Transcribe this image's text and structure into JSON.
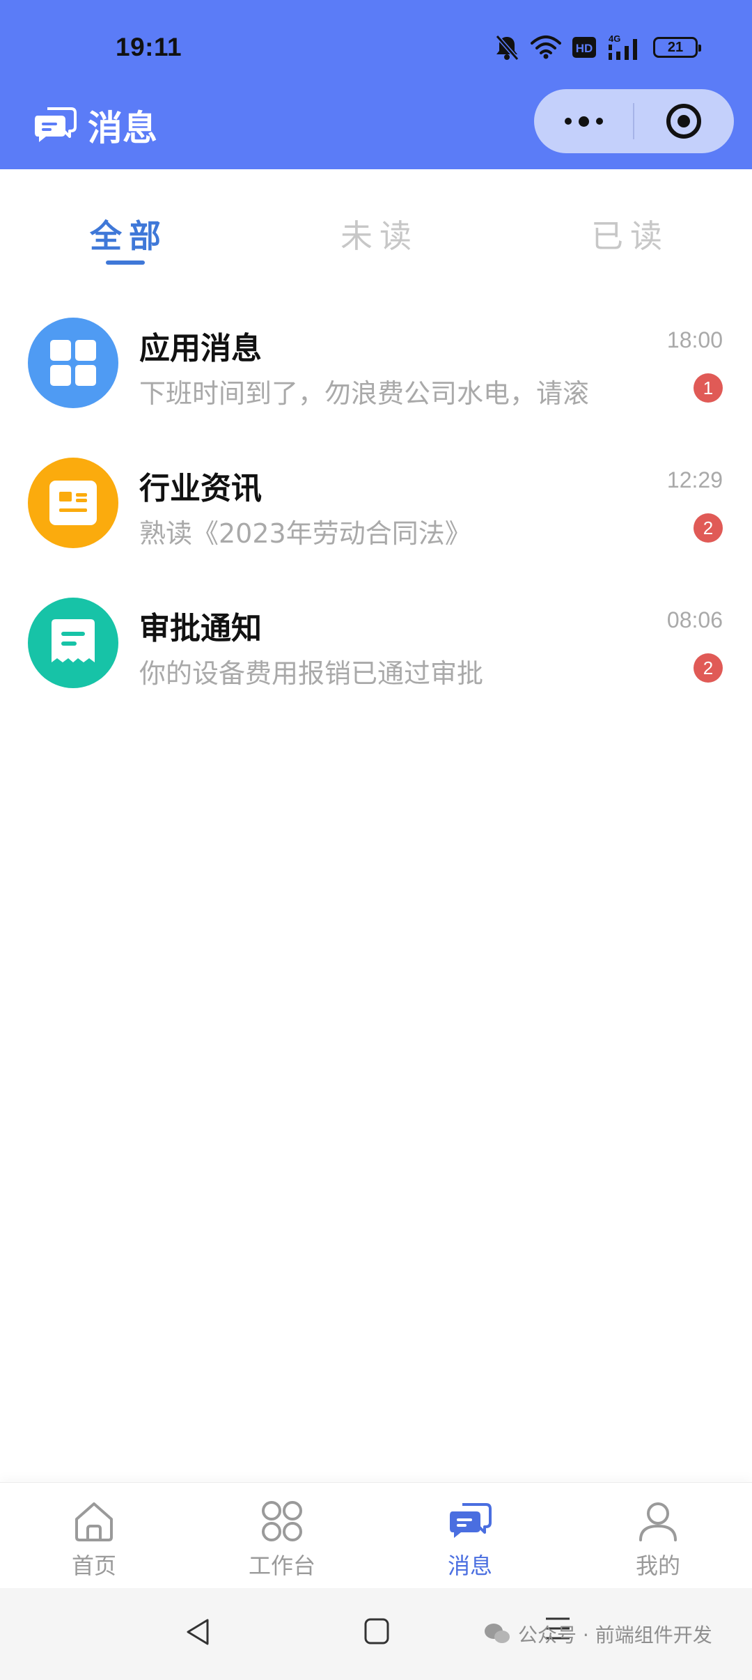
{
  "status_bar": {
    "time": "19:11",
    "network": "4G",
    "hd": "HD",
    "battery": "21",
    "icons": [
      "bell-off-icon",
      "wifi-icon",
      "hd-icon",
      "signal-icon",
      "battery-icon"
    ]
  },
  "header": {
    "title": "消息",
    "icon": "chat-bubbles-icon",
    "background": "#5b7cf7"
  },
  "tabs": [
    {
      "label": "全部",
      "active": true
    },
    {
      "label": "未读",
      "active": false
    },
    {
      "label": "已读",
      "active": false
    }
  ],
  "messages": [
    {
      "title": "应用消息",
      "preview": "下班时间到了，勿浪费公司水电，请滚",
      "time": "18:00",
      "badge": "1",
      "icon": "grid-apps-icon",
      "color": "#4f9bf3"
    },
    {
      "title": "行业资讯",
      "preview": "熟读《2023年劳动合同法》",
      "time": "12:29",
      "badge": "2",
      "icon": "news-icon",
      "color": "#fbab0d"
    },
    {
      "title": "审批通知",
      "preview": "你的设备费用报销已通过审批",
      "time": "08:06",
      "badge": "2",
      "icon": "receipt-icon",
      "color": "#17c3a7"
    }
  ],
  "tabbar": [
    {
      "label": "首页",
      "icon": "home-icon",
      "active": false
    },
    {
      "label": "工作台",
      "icon": "workbench-icon",
      "active": false
    },
    {
      "label": "消息",
      "icon": "message-icon",
      "active": true
    },
    {
      "label": "我的",
      "icon": "user-icon",
      "active": false
    }
  ],
  "watermark": {
    "text": "公众号 · 前端组件开发"
  }
}
